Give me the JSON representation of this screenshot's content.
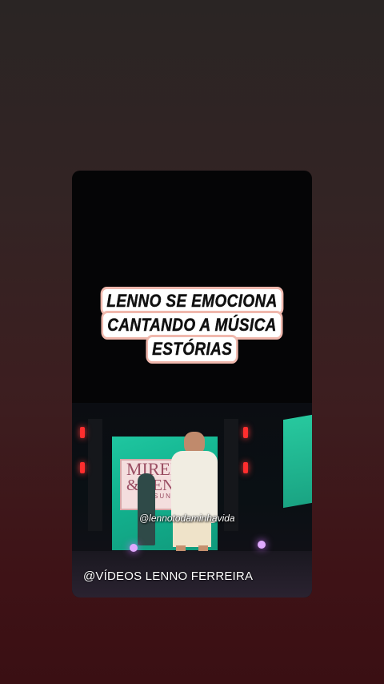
{
  "story": {
    "title_lines": [
      "LENNO SE EMOCIONA",
      "CANTANDO A MÚSICA",
      "ESTÓRIAS"
    ],
    "handle": "@lennotodaminhavida",
    "watermark": "@VÍDEOS LENNO FERREIRA",
    "banner_text": {
      "line1": "MIREL",
      "line2": "& LENN",
      "line3": "SUNSE"
    }
  },
  "colors": {
    "title_bg": "#ffffff",
    "title_outline": "#f0b8ad",
    "screen_green": "#1fc6a0"
  }
}
